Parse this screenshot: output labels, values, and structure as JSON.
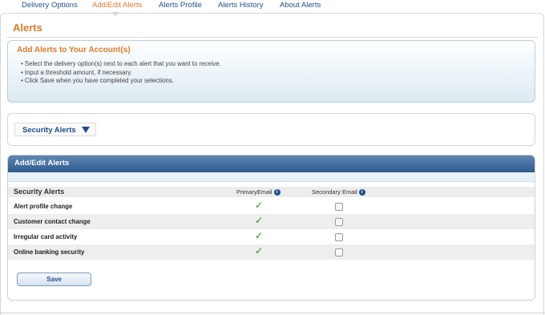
{
  "nav": {
    "tabs": [
      {
        "label": "Delivery Options"
      },
      {
        "label": "Add/Edit Alerts"
      },
      {
        "label": "Alerts Profile"
      },
      {
        "label": "Alerts History"
      },
      {
        "label": "About Alerts"
      }
    ],
    "active_tab": "Add/Edit Alerts"
  },
  "page": {
    "title": "Alerts"
  },
  "info": {
    "title": "Add Alerts to Your Account(s)",
    "items": [
      "Select the delivery option(s) next to each alert that you want to receive.",
      "Input a threshold amount, if necessary.",
      "Click Save when you have completed your selections."
    ]
  },
  "category_select": {
    "selected": "Security Alerts"
  },
  "alerts_panel": {
    "title": "Add/Edit Alerts",
    "table": {
      "headers": {
        "name": "Security Alerts",
        "primary": "PrimaryEmail",
        "secondary": "Secondary Email"
      },
      "rows": [
        {
          "name": "Alert profile change",
          "primary": true,
          "secondary": false
        },
        {
          "name": "Customer contact change",
          "primary": true,
          "secondary": false
        },
        {
          "name": "Irregular card activity",
          "primary": true,
          "secondary": false
        },
        {
          "name": "Online banking security",
          "primary": true,
          "secondary": false
        }
      ]
    },
    "save_label": "Save"
  },
  "icons": {
    "check": "check-icon",
    "info": "info-icon",
    "dropdown": "triangle-down-icon"
  },
  "colors": {
    "accent": "#e07b2a",
    "link": "#1f4e8c",
    "header_bar": "#3f6a9c",
    "check": "#2e8b1e"
  }
}
